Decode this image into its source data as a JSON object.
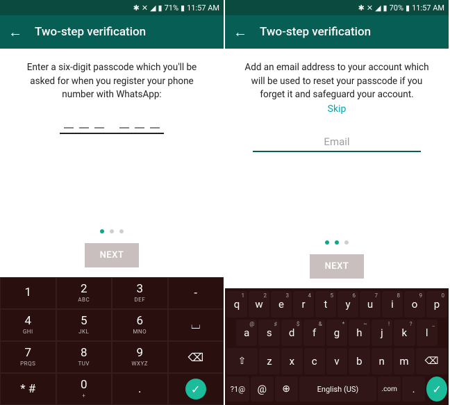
{
  "left": {
    "status": {
      "battery": "71%",
      "time": "11:57 AM"
    },
    "appbar_title": "Two-step verification",
    "instruction": "Enter a six-digit passcode which you'll be asked for when you register your phone number with WhatsApp:",
    "next_label": "NEXT",
    "step_active": 0,
    "keypad": {
      "r1": [
        {
          "d": "1",
          "l": ""
        },
        {
          "d": "2",
          "l": "ABC"
        },
        {
          "d": "3",
          "l": "DEF"
        },
        {
          "d": "-",
          "l": ""
        }
      ],
      "r2": [
        {
          "d": "4",
          "l": "GHI"
        },
        {
          "d": "5",
          "l": "JKL"
        },
        {
          "d": "6",
          "l": "MNO"
        }
      ],
      "r3": [
        {
          "d": "7",
          "l": "PRQS"
        },
        {
          "d": "8",
          "l": "TUV"
        },
        {
          "d": "9",
          "l": "WXYZ"
        }
      ],
      "r4": [
        {
          "d": "* #",
          "l": ""
        },
        {
          "d": "0",
          "l": "+"
        }
      ]
    }
  },
  "right": {
    "status": {
      "battery": "70%",
      "time": "11:57 AM"
    },
    "appbar_title": "Two-step verification",
    "instruction": "Add an email address to your account which will be used to reset your passcode if you forget it and safeguard your account.",
    "skip_label": "Skip",
    "email_placeholder": "Email",
    "next_label": "NEXT",
    "step_active": 1,
    "qwerty": {
      "row1": [
        {
          "c": "q",
          "h": "1"
        },
        {
          "c": "w",
          "h": "2"
        },
        {
          "c": "e",
          "h": "3"
        },
        {
          "c": "r",
          "h": "4"
        },
        {
          "c": "t",
          "h": "5"
        },
        {
          "c": "y",
          "h": "6"
        },
        {
          "c": "u",
          "h": "7"
        },
        {
          "c": "i",
          "h": "8"
        },
        {
          "c": "o",
          "h": "9"
        },
        {
          "c": "p",
          "h": "0"
        }
      ],
      "row2": [
        {
          "c": "a",
          "h": "@"
        },
        {
          "c": "s",
          "h": "♯"
        },
        {
          "c": "d",
          "h": "$"
        },
        {
          "c": "f",
          "h": "&"
        },
        {
          "c": "g",
          "h": "*"
        },
        {
          "c": "h",
          "h": "~"
        },
        {
          "c": "j",
          "h": "!"
        },
        {
          "c": "k",
          "h": "?"
        },
        {
          "c": "l",
          "h": "_"
        }
      ],
      "row3": [
        {
          "c": "z",
          "h": ""
        },
        {
          "c": "x",
          "h": ""
        },
        {
          "c": "c",
          "h": ""
        },
        {
          "c": "v",
          "h": ""
        },
        {
          "c": "b",
          "h": ""
        },
        {
          "c": "n",
          "h": ""
        },
        {
          "c": "m",
          "h": ""
        }
      ],
      "bottom": {
        "symnum": "?1@",
        "at": "@",
        "lang_label": "English (US)",
        "dotcom": ".com",
        "period": "."
      }
    }
  }
}
